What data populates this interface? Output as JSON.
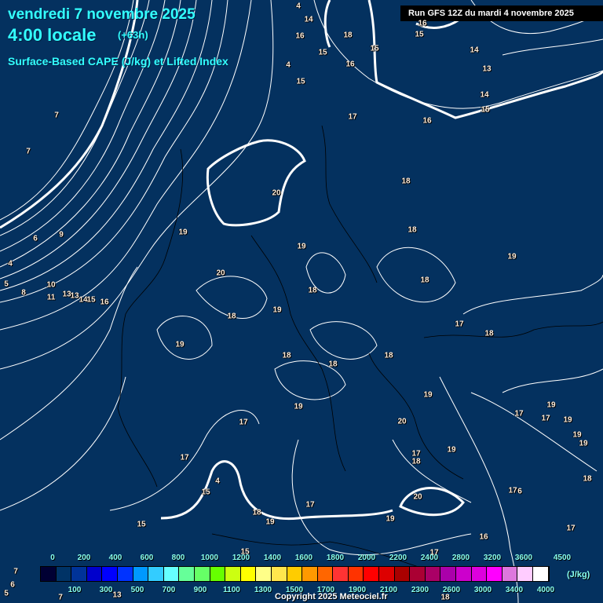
{
  "header": {
    "date": "vendredi 7 novembre 2025",
    "time": "4:00 locale",
    "lead": "(+63h)",
    "parameter": "Surface-Based CAPE (J/kg) et Lifted Index",
    "run": "Run GFS 12Z du mardi 4 novembre 2025"
  },
  "contour_labels": [
    "4",
    "14",
    "16",
    "18",
    "16",
    "15",
    "15",
    "15",
    "14",
    "16",
    "13",
    "15",
    "4",
    "14",
    "15",
    "17",
    "16",
    "7",
    "7",
    "18",
    "20",
    "19",
    "18",
    "9",
    "6",
    "19",
    "19",
    "4",
    "20",
    "18",
    "5",
    "10",
    "8",
    "13",
    "11",
    "13",
    "14",
    "15",
    "16",
    "18",
    "19",
    "18",
    "17",
    "18",
    "19",
    "18",
    "18",
    "18",
    "19",
    "19",
    "19",
    "17",
    "17",
    "19",
    "17",
    "20",
    "19",
    "19",
    "19",
    "17",
    "18",
    "17",
    "18",
    "4",
    "15",
    "17",
    "6",
    "20",
    "17",
    "18",
    "19",
    "19",
    "15",
    "16",
    "17",
    "15",
    "17",
    "7",
    "6",
    "5",
    "7",
    "13",
    "18"
  ],
  "legend": {
    "colors": [
      "#000033",
      "#003366",
      "#003399",
      "#0000cc",
      "#0000ff",
      "#0033ff",
      "#0099ff",
      "#33ccff",
      "#66ffff",
      "#66ff99",
      "#66ff66",
      "#66ff00",
      "#ccff11",
      "#ffff00",
      "#ffff88",
      "#ffe64d",
      "#ffcc00",
      "#ff9900",
      "#ff6600",
      "#ff3333",
      "#ff3300",
      "#ff0000",
      "#dd0000",
      "#aa0000",
      "#aa0033",
      "#aa0066",
      "#aa00aa",
      "#cc00cc",
      "#dd00dd",
      "#ff00ff",
      "#dd77dd",
      "#ffccff",
      "#ffffff"
    ],
    "top_labels": [
      "0",
      "200",
      "400",
      "600",
      "800",
      "1000",
      "1200",
      "1400",
      "1600",
      "1800",
      "2000",
      "2200",
      "2400",
      "2800",
      "3200",
      "3600",
      "4500"
    ],
    "bottom_labels": [
      "100",
      "300",
      "500",
      "700",
      "900",
      "1100",
      "1300",
      "1500",
      "1700",
      "1900",
      "2100",
      "2300",
      "2600",
      "3000",
      "3400",
      "4000"
    ],
    "unit": "(J/kg)"
  },
  "copyright": "Copyright 2025 Meteociel.fr"
}
